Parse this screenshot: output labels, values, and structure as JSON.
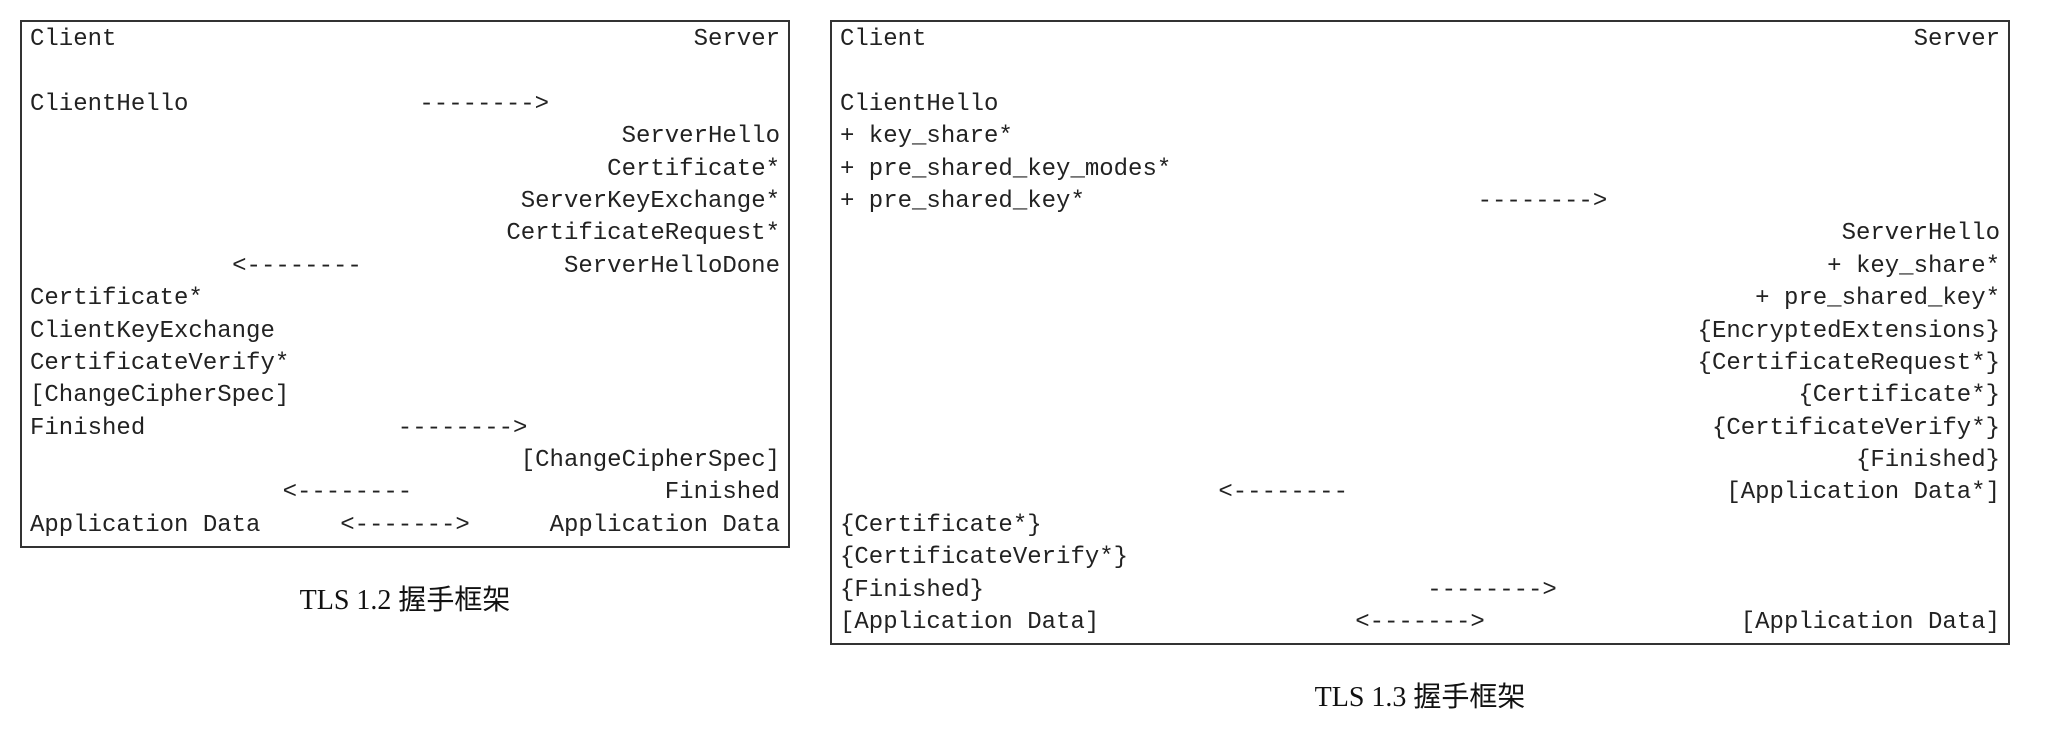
{
  "arrows": {
    "right": "-------->",
    "left": "<--------",
    "both": "<------->"
  },
  "tls12": {
    "caption": "TLS 1.2 握手框架",
    "header_left": "Client",
    "header_right": "Server",
    "rows": [
      {
        "l": "ClientHello",
        "m": "r",
        "r": ""
      },
      {
        "l": "",
        "m": "",
        "r": "ServerHello"
      },
      {
        "l": "",
        "m": "",
        "r": "Certificate*"
      },
      {
        "l": "",
        "m": "",
        "r": "ServerKeyExchange*"
      },
      {
        "l": "",
        "m": "",
        "r": "CertificateRequest*"
      },
      {
        "l": "",
        "m": "l",
        "r": "ServerHelloDone"
      },
      {
        "l": "Certificate*",
        "m": "",
        "r": ""
      },
      {
        "l": "ClientKeyExchange",
        "m": "",
        "r": ""
      },
      {
        "l": "CertificateVerify*",
        "m": "",
        "r": ""
      },
      {
        "l": "[ChangeCipherSpec]",
        "m": "",
        "r": ""
      },
      {
        "l": "Finished",
        "m": "r",
        "r": ""
      },
      {
        "l": "",
        "m": "",
        "r": "[ChangeCipherSpec]"
      },
      {
        "l": "",
        "m": "l",
        "r": "Finished"
      },
      {
        "l": "Application Data",
        "m": "b",
        "r": "Application Data"
      }
    ]
  },
  "tls13": {
    "caption": "TLS 1.3 握手框架",
    "header_left": "Client",
    "header_right": "Server",
    "rows": [
      {
        "l": "ClientHello",
        "m": "",
        "r": ""
      },
      {
        "l": "+ key_share*",
        "m": "",
        "r": ""
      },
      {
        "l": "+ pre_shared_key_modes*",
        "m": "",
        "r": ""
      },
      {
        "l": "+ pre_shared_key*",
        "m": "r",
        "r": ""
      },
      {
        "l": "",
        "m": "",
        "r": "ServerHello"
      },
      {
        "l": "",
        "m": "",
        "r": "+ key_share*"
      },
      {
        "l": "",
        "m": "",
        "r": "+ pre_shared_key*"
      },
      {
        "l": "",
        "m": "",
        "r": "{EncryptedExtensions}"
      },
      {
        "l": "",
        "m": "",
        "r": "{CertificateRequest*}"
      },
      {
        "l": "",
        "m": "",
        "r": "{Certificate*}"
      },
      {
        "l": "",
        "m": "",
        "r": "{CertificateVerify*}"
      },
      {
        "l": "",
        "m": "",
        "r": "{Finished}"
      },
      {
        "l": "",
        "m": "l",
        "r": "[Application Data*]"
      },
      {
        "l": "{Certificate*}",
        "m": "",
        "r": ""
      },
      {
        "l": "{CertificateVerify*}",
        "m": "",
        "r": ""
      },
      {
        "l": "{Finished}",
        "m": "r",
        "r": ""
      },
      {
        "l": "[Application Data]",
        "m": "b",
        "r": "[Application Data]"
      }
    ]
  }
}
